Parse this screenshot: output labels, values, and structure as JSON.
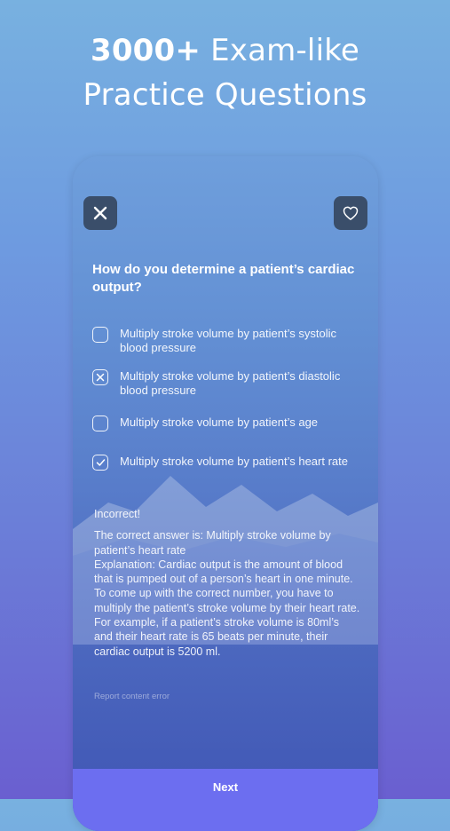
{
  "headline": {
    "line1_bold": "3000+",
    "line1_rest": " Exam-like",
    "line2": "Practice Questions"
  },
  "toolbar": {
    "close_icon": "close-icon",
    "favorite_icon": "heart-icon"
  },
  "question": "How do you determine a patient’s cardiac output?",
  "options": [
    {
      "label": "Multiply stroke volume by patient’s systolic blood pressure",
      "state": "unchecked"
    },
    {
      "label": "Multiply stroke volume by patient’s diastolic blood pressure",
      "state": "wrong"
    },
    {
      "label": "Multiply stroke volume by patient’s age",
      "state": "unchecked"
    },
    {
      "label": "Multiply stroke volume by patient’s heart rate",
      "state": "correct"
    }
  ],
  "feedback": {
    "status": "Incorrect!",
    "body": "The correct answer is: Multiply stroke volume by patient’s heart rate\nExplanation:  Cardiac output is the amount of blood that is pumped out of a person’s heart in one minute. To come up with the correct number, you have to multiply the patient’s stroke volume by their heart rate. For example, if a patient’s stroke volume is 80ml’s and their heart rate is 65 beats per minute, their cardiac output is 5200 ml."
  },
  "report_link": "Report content error",
  "next_label": "Next",
  "colors": {
    "next_bar": "#6c6ef0",
    "icon_button": "#3a4e6a"
  }
}
